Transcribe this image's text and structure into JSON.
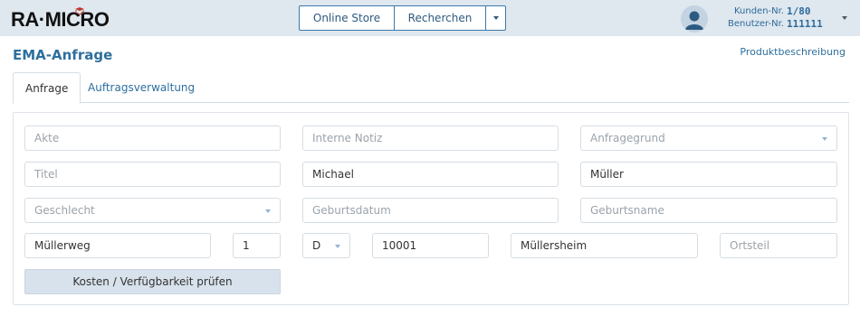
{
  "app": {
    "logo_text": "RA·MICRO"
  },
  "header": {
    "online_store": "Online Store",
    "recherchen": "Recherchen",
    "kunden_label": "Kunden-Nr.",
    "kunden_value": "1/80",
    "benutzer_label": "Benutzer-Nr.",
    "benutzer_value": "111111"
  },
  "page": {
    "title": "EMA-Anfrage",
    "product_link": "Produktbeschreibung"
  },
  "tabs": [
    {
      "label": "Anfrage",
      "active": true
    },
    {
      "label": "Auftragsverwaltung",
      "active": false
    }
  ],
  "form": {
    "akte": {
      "placeholder": "Akte",
      "value": ""
    },
    "interne_notiz": {
      "placeholder": "Interne Notiz",
      "value": ""
    },
    "anfragegrund": {
      "placeholder": "Anfragegrund",
      "value": ""
    },
    "titel": {
      "placeholder": "Titel",
      "value": ""
    },
    "vorname": {
      "placeholder": "",
      "value": "Michael"
    },
    "nachname": {
      "placeholder": "",
      "value": "Müller"
    },
    "geschlecht": {
      "placeholder": "Geschlecht",
      "value": ""
    },
    "geburtsdatum": {
      "placeholder": "Geburtsdatum",
      "value": ""
    },
    "geburtsname": {
      "placeholder": "Geburtsname",
      "value": ""
    },
    "strasse": {
      "value": "Müllerweg"
    },
    "hausnummer": {
      "value": "1"
    },
    "land": {
      "value": "D"
    },
    "plz": {
      "value": "10001"
    },
    "ort": {
      "value": "Müllersheim"
    },
    "ortsteil": {
      "placeholder": "Ortsteil",
      "value": ""
    }
  },
  "actions": {
    "check_label": "Kosten / Verfügbarkeit prüfen"
  }
}
